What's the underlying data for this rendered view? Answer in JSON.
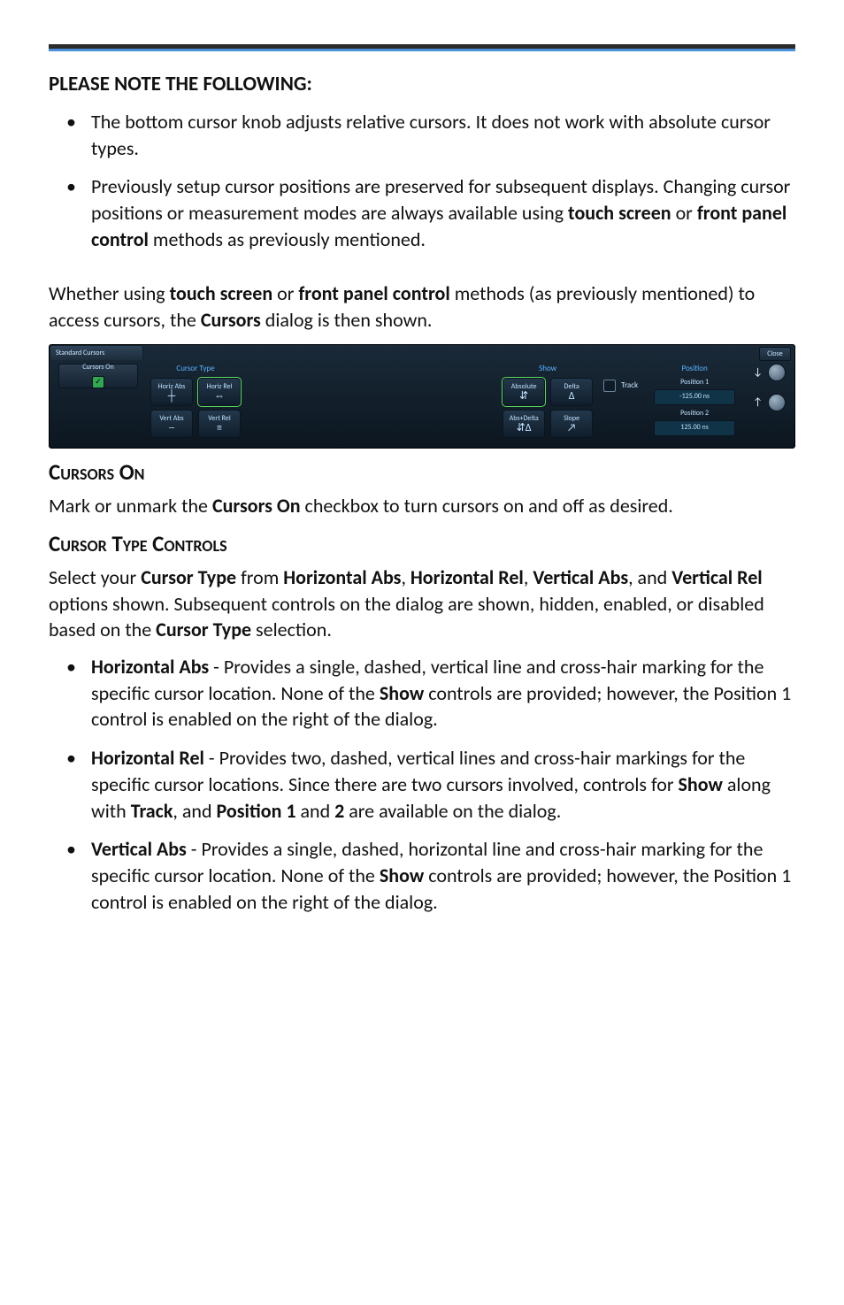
{
  "header_note": "PLEASE NOTE THE FOLLOWING",
  "colon": ":",
  "note_bullets": [
    "The bottom cursor knob adjusts relative cursors. It does not work with absolute cursor types.",
    "Previously setup cursor positions are preserved for subsequent displays. Changing cursor positions or measurement modes are always available using touch screen or front panel control methods as previously mentioned."
  ],
  "bold": {
    "touch": "touch screen",
    "fpc": "front panel control",
    "cursors": "Cursors",
    "cursors_on": "Cursors On"
  },
  "intro": {
    "pre": "Whether using ",
    "mid1": " or ",
    "mid2": " methods (as previously mentioned) to access cursors, the ",
    "post": " dialog is then shown."
  },
  "dlg": {
    "tab": "Standard Cursors",
    "close": "Close",
    "cursor_type_hdr": "Cursor Type",
    "show_hdr": "Show",
    "position_hdr": "Position",
    "cursors_on_label": "Cursors On",
    "horiz_abs": "Horiz Abs",
    "horiz_rel": "Horiz Rel",
    "vert_abs": "Vert Abs",
    "vert_rel": "Vert Rel",
    "absolute": "Absolute",
    "delta": "Delta",
    "abs_delta": "Abs+Delta",
    "slope": "Slope",
    "track": "Track",
    "pos1_label": "Position 1",
    "pos1_val": "-125.00 ns",
    "pos2_label": "Position 2",
    "pos2_val": "125.00 ns"
  },
  "sections": {
    "cursors_on_h": "Cursors On",
    "cursors_on_p_pre": "Mark or unmark the ",
    "cursors_on_p_post": " checkbox to turn cursors on and off as desired.",
    "ctype_h": "Cursor Type Controls",
    "ctype_p": {
      "pre": "Select your ",
      "b1": "Cursor Type",
      "mid1": " from ",
      "b2": "Horizontal Abs",
      "c": ", ",
      "b3": "Horizontal Rel",
      "b4": "Vertical Abs",
      "and": ", and ",
      "b5": "Vertical Rel",
      "post": " options shown. Subsequent controls on the dialog are shown, hidden, enabled, or disabled based on the ",
      "b6": "Cursor Type",
      "post2": " selection."
    },
    "ctype_bullets": [
      {
        "name": "Horizontal Abs",
        "text": " - Provides a single, dashed, vertical line and cross-hair marking for the specific cursor location. None of the ",
        "b": "Show",
        "text2": " controls are provided; however, the Position 1 control is enabled on the right of the dialog."
      },
      {
        "name": "Horizontal Rel",
        "text": " - Provides two, dashed, vertical lines and cross-hair markings for the specific cursor locations. Since there are two cursors involved, controls for ",
        "b": "Show",
        "text2": " along with ",
        "b2": "Track",
        "text3": ", and ",
        "b3": "Position 1",
        "text4": " and ",
        "b4": "2",
        "text5": " are available on the dialog."
      },
      {
        "name": "Vertical Abs",
        "text": " - Provides a single, dashed, horizontal line and cross-hair marking for the specific cursor location. None of the ",
        "b": "Show",
        "text2": " controls are provided; however, the Position 1 control is enabled on the right of the dialog."
      }
    ]
  }
}
